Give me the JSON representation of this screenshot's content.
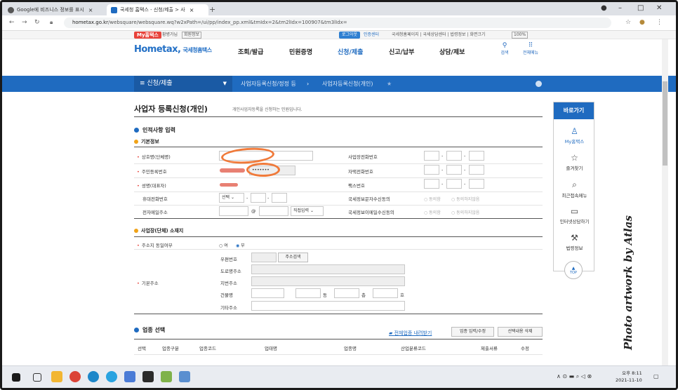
{
  "browser": {
    "tabs": [
      {
        "title": "Google에 비즈니스 정보를 표시"
      },
      {
        "title": "국세청 홈택스 - 신청/제출 > 사"
      }
    ],
    "url_prefix": "hometax.go.kr",
    "url_rest": "/websquare/websquare.wq?w2xPath=/ui/pp/index_pp.xml&tmIdx=2&tm2lIdx=100907&tm3lIdx="
  },
  "topstrip": {
    "my_hometax": "My홈택스",
    "greeting": "황병가님",
    "member_info": "회원정보",
    "logout": "로그아웃",
    "cert_center": "인증센터",
    "links": "국세청홈페이지 | 국세상담센터 | 법령정보 | 화면크기",
    "zoom": "100%"
  },
  "header": {
    "logo": "Hometax,",
    "logo_sub": "국세청홈택스",
    "menus": [
      "조회/발급",
      "민원증명",
      "신청/제출",
      "신고/납부",
      "상담/제보"
    ],
    "search": "검색",
    "all_menu": "전체메뉴"
  },
  "navbar": {
    "section": "≡ 신청/제출",
    "crumb1": "사업자등록신청/정정 등",
    "crumb2": "사업자등록신청(개인)"
  },
  "page": {
    "title": "사업자 등록신청(개인)",
    "subtitle": "개인사업자등록을 신청하는 민원입니다."
  },
  "sections": {
    "personal": "인적사항 입력",
    "basic": "기본정보",
    "address_sec": "사업장(단체) 소재지",
    "industry": "업종 선택"
  },
  "form": {
    "trade_name": "상호명(단체명)",
    "resident_no": "주민등록번호",
    "resident_mask": "•••••••",
    "name": "성명(대표자)",
    "mobile": "휴대전화번호",
    "mobile_select": "선택",
    "email": "전자메일주소",
    "email_at": "@",
    "email_select": "직접입력",
    "biz_phone": "사업장전화번호",
    "home_phone": "자택전화번호",
    "fax": "팩스번호",
    "sms_consent": "국세정보문자수신동의",
    "email_consent": "국세정보이메일수신동의",
    "agree": "동의함",
    "disagree": "동의하지않음",
    "same_address": "주소지 동일여부",
    "yes": "여",
    "no": "부",
    "base_address": "기본주소",
    "postal": "우편번호",
    "addr_search": "주소검색",
    "road_addr": "도로명주소",
    "lot_addr": "지번주소",
    "building": "건물명",
    "dong": "동",
    "floor": "층",
    "ho": "호",
    "other_addr": "기타주소"
  },
  "industry": {
    "all_download": "전체업종 내려받기",
    "enter_edit": "업종 입력/수정",
    "delete_selected": "선택내용 삭제",
    "columns": [
      "선택",
      "업종구분",
      "업종코드",
      "업태명",
      "업종명",
      "산업분류코드",
      "제출서류",
      "수정"
    ]
  },
  "quick": {
    "header": "바로가기",
    "items": [
      "My홈택스",
      "즐겨찾기",
      "최근접속메뉴",
      "인터넷상담하기",
      "법령정보"
    ],
    "top": "TOP"
  },
  "watermark": "Photo artwork by Atlas",
  "taskbar": {
    "time": "오후 8:11",
    "date": "2021-11-10"
  }
}
